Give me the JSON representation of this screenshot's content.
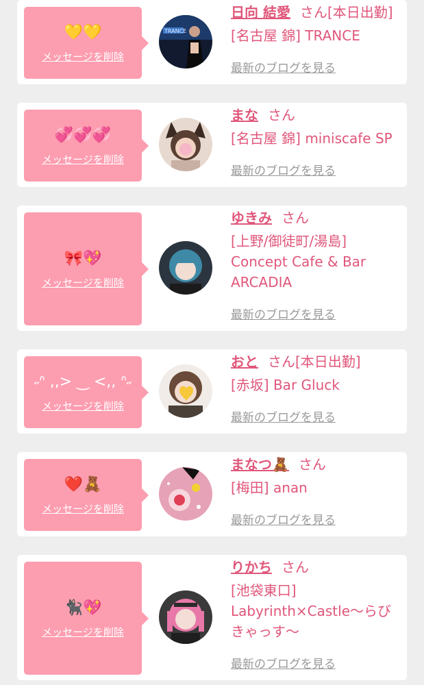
{
  "colors": {
    "bubble": "#fd9db0",
    "accent": "#e0567a",
    "link_gray": "#999999",
    "background": "#eeeeee"
  },
  "delete_label": "メッセージを削除",
  "blog_label": "最新のブログを見る",
  "san_label": "さん",
  "cards": [
    {
      "message": "💛💛",
      "name": "日向 結愛",
      "status": "[本日出勤]",
      "shop": "[名古屋 錦] TRANCE",
      "avatar_icon": "avatar-photo-dark-stage"
    },
    {
      "message": "💞💞💞",
      "name": "まな",
      "status": "",
      "shop": "[名古屋 錦] miniscafe SP",
      "avatar_icon": "avatar-photo-cat-ears"
    },
    {
      "message": "🎀💖",
      "name": "ゆきみ",
      "status": "",
      "shop": "[上野/御徒町/湯島] Concept Cafe & Bar ARCADIA",
      "avatar_icon": "avatar-photo-blue-hair"
    },
    {
      "message": "˶ᐢ ,,> ‿ <,, ᐢ˶",
      "name": "おと",
      "status": "[本日出勤]",
      "shop": "[赤坂] Bar Gluck",
      "avatar_icon": "avatar-photo-heart-sticker"
    },
    {
      "message": "❤️🧸",
      "name": "まなつ🧸",
      "status": "",
      "shop": "[梅田] anan",
      "avatar_icon": "avatar-photo-pink-glitter"
    },
    {
      "message": "🐈‍⬛💖",
      "name": "りかち",
      "status": "",
      "shop": "[池袋東口] Labyrinth×Castle〜らびきゃっす〜",
      "avatar_icon": "avatar-photo-pink-twintails"
    }
  ]
}
